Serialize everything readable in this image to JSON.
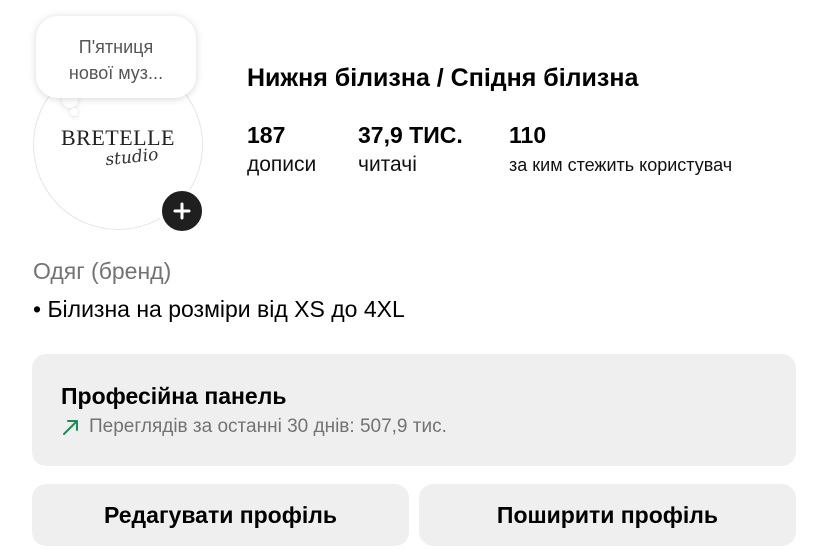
{
  "note": {
    "text_line1": "П'ятниця",
    "text_line2": "нової муз..."
  },
  "avatar": {
    "logo_main": "BRETELLE",
    "logo_sub": "studio"
  },
  "profile": {
    "name": "Нижня білизна / Спідня білизна",
    "stats": [
      {
        "value": "187",
        "label": "дописи"
      },
      {
        "value": "37,9 ТИС.",
        "label": "читачі"
      },
      {
        "value": "110",
        "label": "за ким стежить користувач"
      }
    ],
    "category": "Одяг (бренд)",
    "bio": "• Білизна на розміри від XS до 4XL"
  },
  "dashboard": {
    "title": "Професійна панель",
    "stats_text": "Переглядів за останні 30 днів: 507,9 тис.",
    "trend_color": "#1e8a5b"
  },
  "buttons": {
    "edit_label": "Редагувати профіль",
    "share_label": "Поширити профіль"
  },
  "icons": {
    "add": "plus-icon",
    "trend": "trend-up-arrow-icon"
  }
}
